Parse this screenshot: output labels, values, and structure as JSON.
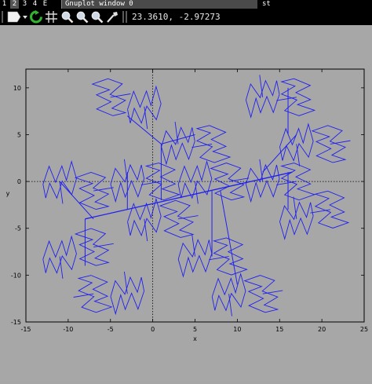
{
  "taskbar": {
    "workspaces": [
      "1",
      "2",
      "3",
      "4",
      "E"
    ],
    "window_title": "Gnuplot window 0",
    "right_label": "st"
  },
  "toolbar": {
    "coordinates": "23.3610, -2.97273",
    "icons": [
      "copy-clipboard-icon",
      "replot-icon",
      "grid-icon",
      "zoom-previous-icon",
      "zoom-next-icon",
      "unzoom-icon",
      "mouse-toggle-icon"
    ]
  },
  "plot": {
    "xlabel": "x",
    "ylabel": "y",
    "xticks": [
      "-15",
      "-10",
      "-5",
      "0",
      "5",
      "10",
      "15",
      "20",
      "25"
    ],
    "yticks": [
      "10",
      "5",
      "0",
      "-5",
      "-10",
      "-15"
    ],
    "line_color": "#2020f0"
  },
  "chart_data": {
    "type": "line",
    "title": "",
    "xlabel": "x",
    "ylabel": "y",
    "xlim": [
      -15,
      25
    ],
    "ylim": [
      -15,
      12
    ],
    "xticks": [
      -15,
      -10,
      -5,
      0,
      5,
      10,
      15,
      20,
      25
    ],
    "yticks": [
      -15,
      -10,
      -5,
      0,
      5,
      10
    ],
    "grid": false,
    "zero_axes": true,
    "series": [
      {
        "description": "fractal",
        "color": "#2020f0",
        "trunk": [
          [
            -8,
            -4
          ],
          [
            16.5,
            1
          ]
        ],
        "branches": [
          [
            [
              -8,
              -4
            ],
            [
              -8,
              -9
            ]
          ],
          [
            [
              -7,
              -4
            ],
            [
              -11,
              0
            ]
          ],
          [
            [
              -3,
              -3
            ],
            [
              -3,
              1
            ]
          ],
          [
            [
              1,
              -2
            ],
            [
              1,
              4
            ]
          ],
          [
            [
              1,
              4
            ],
            [
              -3,
              7
            ]
          ],
          [
            [
              1,
              4
            ],
            [
              5,
              5
            ]
          ],
          [
            [
              7,
              -1
            ],
            [
              7,
              -8
            ]
          ],
          [
            [
              13,
              1
            ],
            [
              17,
              5
            ]
          ],
          [
            [
              16,
              1
            ],
            [
              16,
              -3
            ]
          ],
          [
            [
              16,
              5
            ],
            [
              16,
              10
            ]
          ],
          [
            [
              8,
              -1
            ],
            [
              10,
              -11
            ]
          ]
        ],
        "motif_centers": [
          [
            -11,
            0
          ],
          [
            -7,
            -1
          ],
          [
            -3,
            0
          ],
          [
            1,
            0
          ],
          [
            5,
            0
          ],
          [
            9,
            0
          ],
          [
            13,
            0
          ],
          [
            17,
            0
          ],
          [
            -11,
            -8
          ],
          [
            -7,
            -7
          ],
          [
            -3,
            -12
          ],
          [
            -7,
            -12
          ],
          [
            -1,
            8
          ],
          [
            -5,
            9
          ],
          [
            3,
            4
          ],
          [
            7,
            4
          ],
          [
            -1,
            -4
          ],
          [
            3,
            -4
          ],
          [
            5,
            -8
          ],
          [
            9,
            -8
          ],
          [
            9,
            -12
          ],
          [
            13,
            -12
          ],
          [
            13,
            9
          ],
          [
            17,
            9
          ],
          [
            17,
            4
          ],
          [
            21,
            4
          ],
          [
            17,
            -4
          ],
          [
            21,
            -3
          ]
        ]
      }
    ]
  }
}
